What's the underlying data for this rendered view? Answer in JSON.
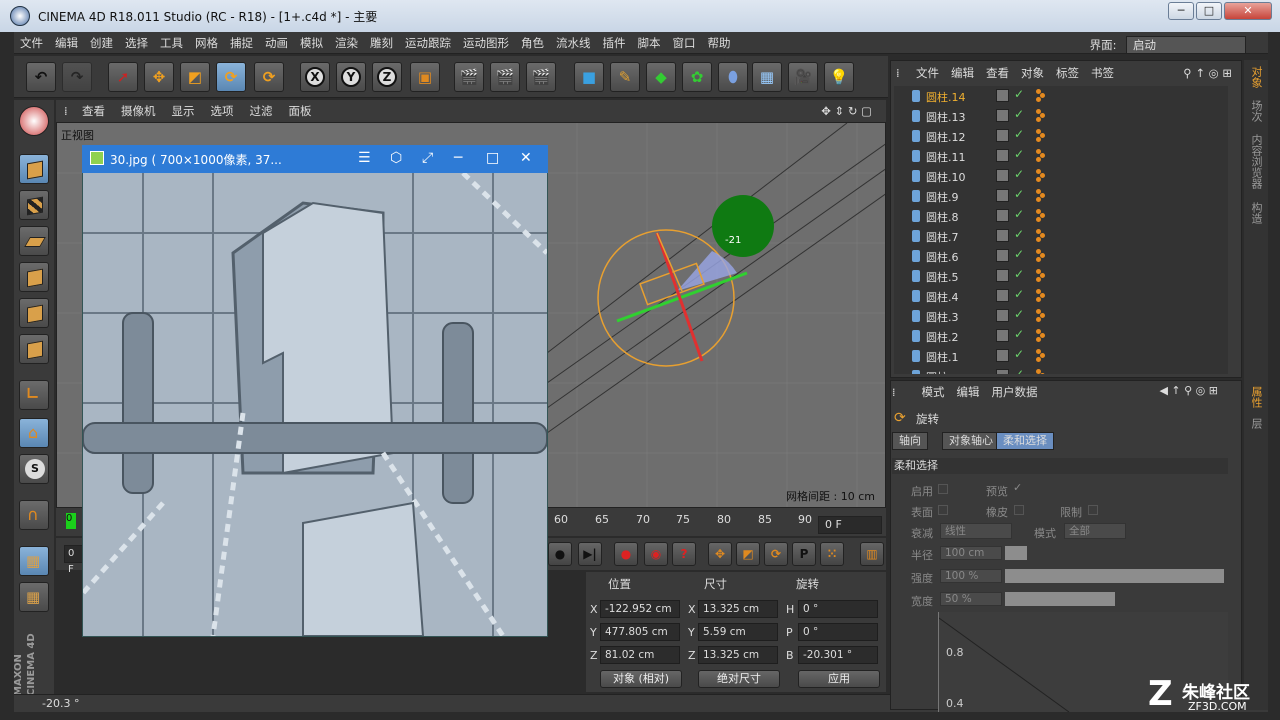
{
  "window": {
    "title": "CINEMA 4D R18.011 Studio (RC - R18) - [1+.c4d *] - 主要",
    "buttons": [
      "─",
      "□",
      "✕"
    ]
  },
  "menu": {
    "items": [
      "文件",
      "编辑",
      "创建",
      "选择",
      "工具",
      "网格",
      "捕捉",
      "动画",
      "模拟",
      "渲染",
      "雕刻",
      "运动跟踪",
      "运动图形",
      "角色",
      "流水线",
      "插件",
      "脚本",
      "窗口",
      "帮助"
    ],
    "interface_label": "界面:",
    "interface_value": "启动"
  },
  "toolbar": {
    "axes": [
      "X",
      "Y",
      "Z"
    ]
  },
  "viewport": {
    "menu": [
      "查看",
      "摄像机",
      "显示",
      "选项",
      "过滤",
      "面板"
    ],
    "view_name": "正视图",
    "grid_info": "网格间距 : 10 cm",
    "rotation_readout": "-21"
  },
  "image_viewer": {
    "title": "30.jpg ( 700×1000像素, 37...",
    "controls": [
      "☰",
      "⬡",
      "⤢",
      "─",
      "□",
      "✕"
    ]
  },
  "timeline": {
    "ticks": [
      "60",
      "65",
      "70",
      "75",
      "80",
      "85",
      "90"
    ],
    "current_frame": "0 F",
    "start_frame": "0 F",
    "start_tick": "0"
  },
  "coords": {
    "headers": {
      "position": "位置",
      "size": "尺寸",
      "rotation": "旋转"
    },
    "rows": [
      {
        "axis": "X",
        "pos": "-122.952 cm",
        "size_axis": "X",
        "size": "13.325 cm",
        "rot_axis": "H",
        "rot": "0 °"
      },
      {
        "axis": "Y",
        "pos": "477.805 cm",
        "size_axis": "Y",
        "size": "5.59 cm",
        "rot_axis": "P",
        "rot": "0 °"
      },
      {
        "axis": "Z",
        "pos": "81.02 cm",
        "size_axis": "Z",
        "size": "13.325 cm",
        "rot_axis": "B",
        "rot": "-20.301 °"
      }
    ],
    "mode_dropdown": "对象 (相对)",
    "size_dropdown": "绝对尺寸",
    "apply_button": "应用"
  },
  "status": {
    "text": "-20.3 °"
  },
  "brand": {
    "vertical": "MAXON CINEMA 4D"
  },
  "object_manager": {
    "menu": [
      "文件",
      "编辑",
      "查看",
      "对象",
      "标签",
      "书签"
    ],
    "objects": [
      "圆柱.14",
      "圆柱.13",
      "圆柱.12",
      "圆柱.11",
      "圆柱.10",
      "圆柱.9",
      "圆柱.8",
      "圆柱.7",
      "圆柱.6",
      "圆柱.5",
      "圆柱.4",
      "圆柱.3",
      "圆柱.2",
      "圆柱.1",
      "圆柱"
    ],
    "selected": "圆柱.14"
  },
  "attributes": {
    "menu": [
      "模式",
      "编辑",
      "用户数据"
    ],
    "tool_name": "旋转",
    "tabs": [
      "轴向",
      "对象轴心",
      "柔和选择"
    ],
    "active_tab": "柔和选择",
    "section_title": "柔和选择",
    "enable_label": "启用",
    "preview_label": "预览",
    "surface_label": "表面",
    "rubber_label": "橡皮",
    "restrict_label": "限制",
    "falloff_label": "衰减",
    "falloff_value": "线性",
    "mode_label": "模式",
    "mode_value": "全部",
    "radius_label": "半径",
    "radius_value": "100 cm",
    "strength_label": "强度",
    "strength_value": "100 %",
    "width_label": "宽度",
    "width_value": "50 %",
    "graph_labels": [
      "0.8",
      "0.4"
    ]
  },
  "side_tabs": [
    "对象",
    "场次",
    "内容浏览器",
    "构造",
    "属性",
    "层"
  ],
  "watermark": {
    "name": "朱峰社区",
    "url": "ZF3D.COM"
  },
  "colors": {
    "accent": "#6a8ec0",
    "selection_orange": "#e8a030",
    "green_cursor": "#0f7a12",
    "x_axis": "#e03030",
    "y_axis": "#30d030"
  }
}
